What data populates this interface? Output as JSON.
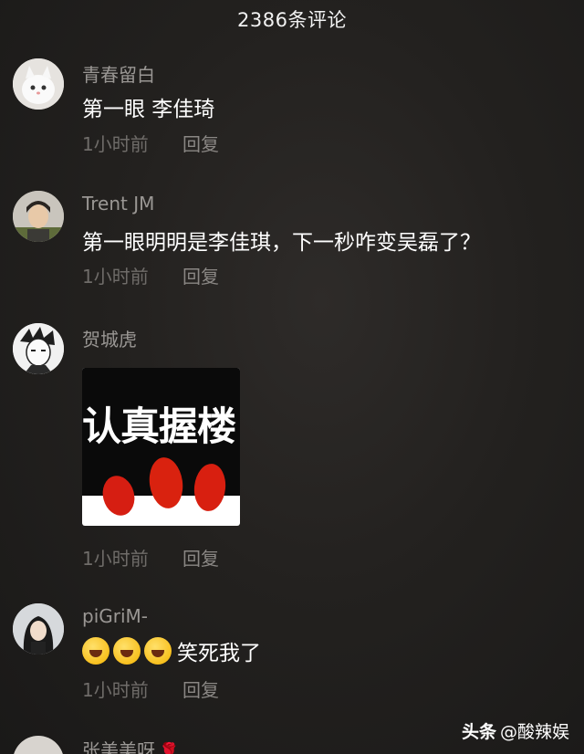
{
  "header": {
    "title": "2386条评论"
  },
  "comments": [
    {
      "user": "青春留白",
      "text": "第一眼 李佳琦",
      "time": "1小时前",
      "reply": "回复"
    },
    {
      "user": "Trent JM",
      "text": "第一眼明明是李佳琪，下一秒咋变吴磊了？",
      "time": "1小时前",
      "reply": "回复"
    },
    {
      "user": "贺城虎",
      "sticker_text": "认真握楼",
      "time": "1小时前",
      "reply": "回复"
    },
    {
      "user": "piGriM-",
      "text": "笑死我了",
      "emoji": [
        "face-with-tears-of-joy-icon",
        "face-with-tears-of-joy-icon",
        "face-with-tears-of-joy-icon"
      ],
      "time": "1小时前",
      "reply": "回复"
    },
    {
      "user": "张美美呀"
    }
  ],
  "watermark": {
    "brand": "头条",
    "handle": "@酸辣娱"
  },
  "colors": {
    "background": "#23211f",
    "username": "#9a9794",
    "meta": "#6f6c69",
    "rose": "#d0242c"
  }
}
